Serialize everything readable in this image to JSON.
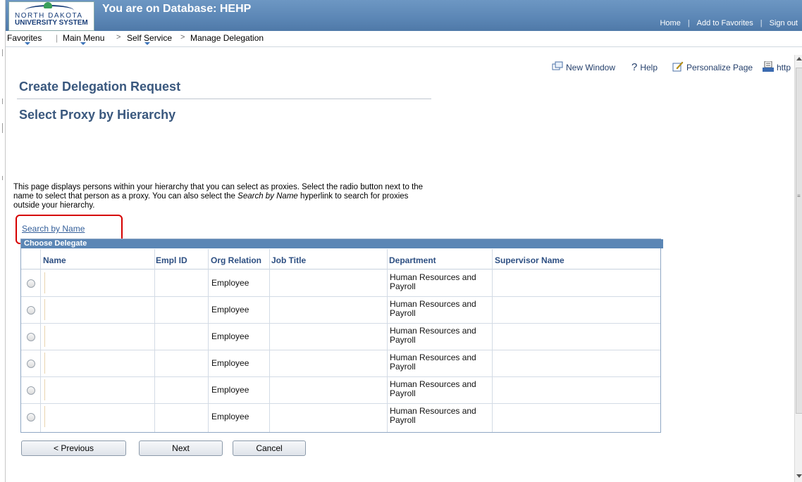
{
  "header": {
    "logo_line1": "NORTH DAKOTA",
    "logo_line2": "UNIVERSITY SYSTEM",
    "database_title": "You are on Database: HEHP",
    "links": [
      "Home",
      "Add to Favorites",
      "Sign out"
    ]
  },
  "nav": {
    "favorites": "Favorites",
    "main_menu": "Main Menu",
    "breadcrumb_sep": ">",
    "self_service": "Self Service",
    "manage_delegation": "Manage Delegation"
  },
  "utility": {
    "new_window": "New Window",
    "help": "Help",
    "personalize": "Personalize Page",
    "http": "http"
  },
  "page": {
    "title": "Create Delegation Request",
    "subtitle": "Select Proxy by Hierarchy",
    "intro_part1": "This page displays persons within your hierarchy that you can select as proxies. Select the radio button next to the name to select that person as a proxy. You can also select the ",
    "intro_italic": "Search by Name",
    "intro_part2": " hyperlink to search for proxies outside your hierarchy.",
    "search_link": "Search by Name"
  },
  "grid": {
    "title": "Choose Delegate",
    "columns": {
      "name": "Name",
      "empl_id": "Empl ID",
      "org_relation": "Org Relation",
      "job_title": "Job Title",
      "department": "Department",
      "supervisor": "Supervisor Name"
    },
    "rows": [
      {
        "org_relation": "Employee",
        "department": "Human Resources and Payroll"
      },
      {
        "org_relation": "Employee",
        "department": "Human Resources and Payroll"
      },
      {
        "org_relation": "Employee",
        "department": "Human Resources and Payroll"
      },
      {
        "org_relation": "Employee",
        "department": "Human Resources and Payroll"
      },
      {
        "org_relation": "Employee",
        "department": "Human Resources and Payroll"
      },
      {
        "org_relation": "Employee",
        "department": "Human Resources and Payroll"
      }
    ]
  },
  "buttons": {
    "previous": "< Previous",
    "next": "Next",
    "cancel": "Cancel"
  }
}
